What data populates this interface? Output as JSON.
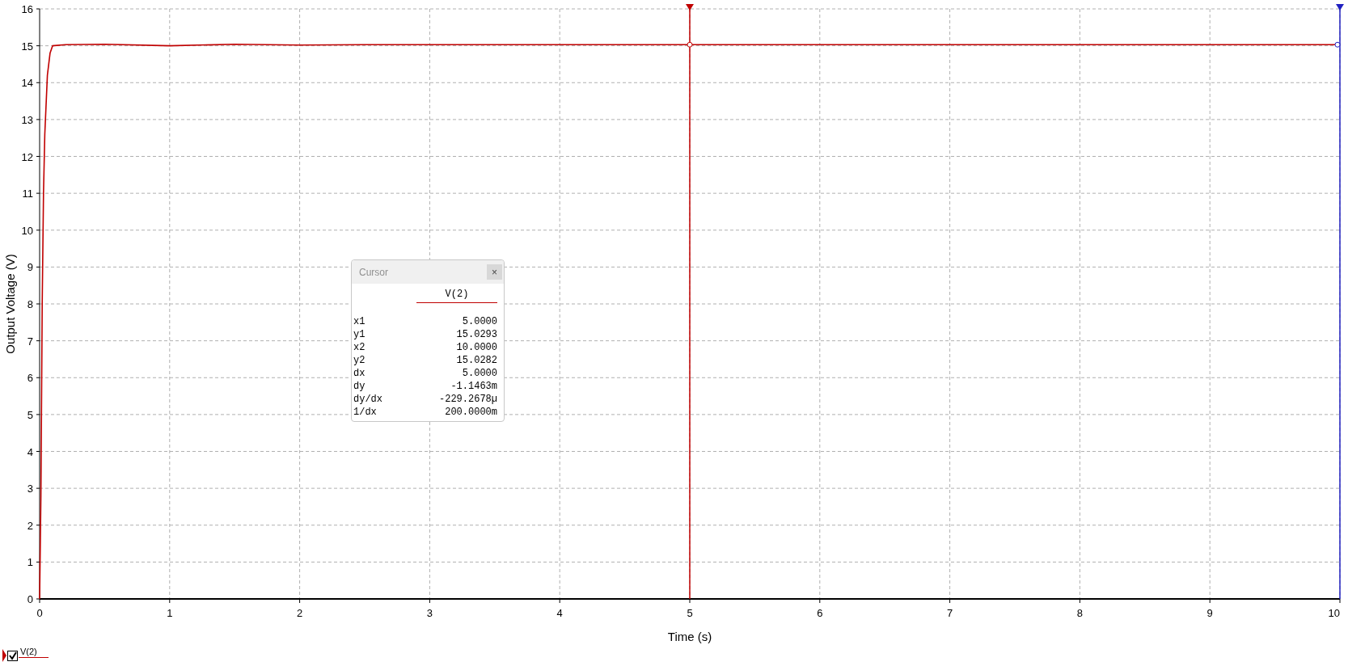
{
  "plot": {
    "chart_data": {
      "type": "line",
      "xlabel": "Time (s)",
      "ylabel": "Output Voltage (V)",
      "x": [
        0,
        0.01,
        0.02,
        0.03,
        0.04,
        0.06,
        0.08,
        0.1,
        0.2,
        0.5,
        1,
        1.5,
        2,
        2.5,
        3,
        3.5,
        4,
        5,
        6,
        7,
        8,
        9,
        10
      ],
      "series": [
        {
          "name": "V(2)",
          "color": "#c00000",
          "values": [
            0,
            2.8,
            8,
            11,
            12.6,
            14.2,
            14.8,
            15.0,
            15.03,
            15.04,
            15.0,
            15.04,
            15.02,
            15.03,
            15.03,
            15.03,
            15.03,
            15.03,
            15.03,
            15.03,
            15.03,
            15.03,
            15.03
          ]
        }
      ],
      "xlim": [
        0,
        10
      ],
      "ylim": [
        0,
        16
      ],
      "xticks": [
        0,
        1,
        2,
        3,
        4,
        5,
        6,
        7,
        8,
        9,
        10
      ],
      "yticks": [
        0,
        1,
        2,
        3,
        4,
        5,
        6,
        7,
        8,
        9,
        10,
        11,
        12,
        13,
        14,
        15,
        16
      ],
      "grid": true,
      "ref_lines": [
        {
          "axis": "x",
          "value": 5,
          "color": "#c00000"
        },
        {
          "axis": "x",
          "value": 10,
          "color": "#2020c0"
        }
      ]
    }
  },
  "cursor_panel": {
    "title": "Cursor",
    "close": "×",
    "column": "V(2)",
    "rows": [
      {
        "label": "x1",
        "value": "5.0000"
      },
      {
        "label": "y1",
        "value": "15.0293"
      },
      {
        "label": "x2",
        "value": "10.0000"
      },
      {
        "label": "y2",
        "value": "15.0282"
      },
      {
        "label": "dx",
        "value": "5.0000"
      },
      {
        "label": "dy",
        "value": "-1.1463m"
      },
      {
        "label": "dy/dx",
        "value": "-229.2678µ"
      },
      {
        "label": "1/dx",
        "value": "200.0000m"
      }
    ]
  },
  "legend": [
    {
      "checked": true
    }
  ]
}
